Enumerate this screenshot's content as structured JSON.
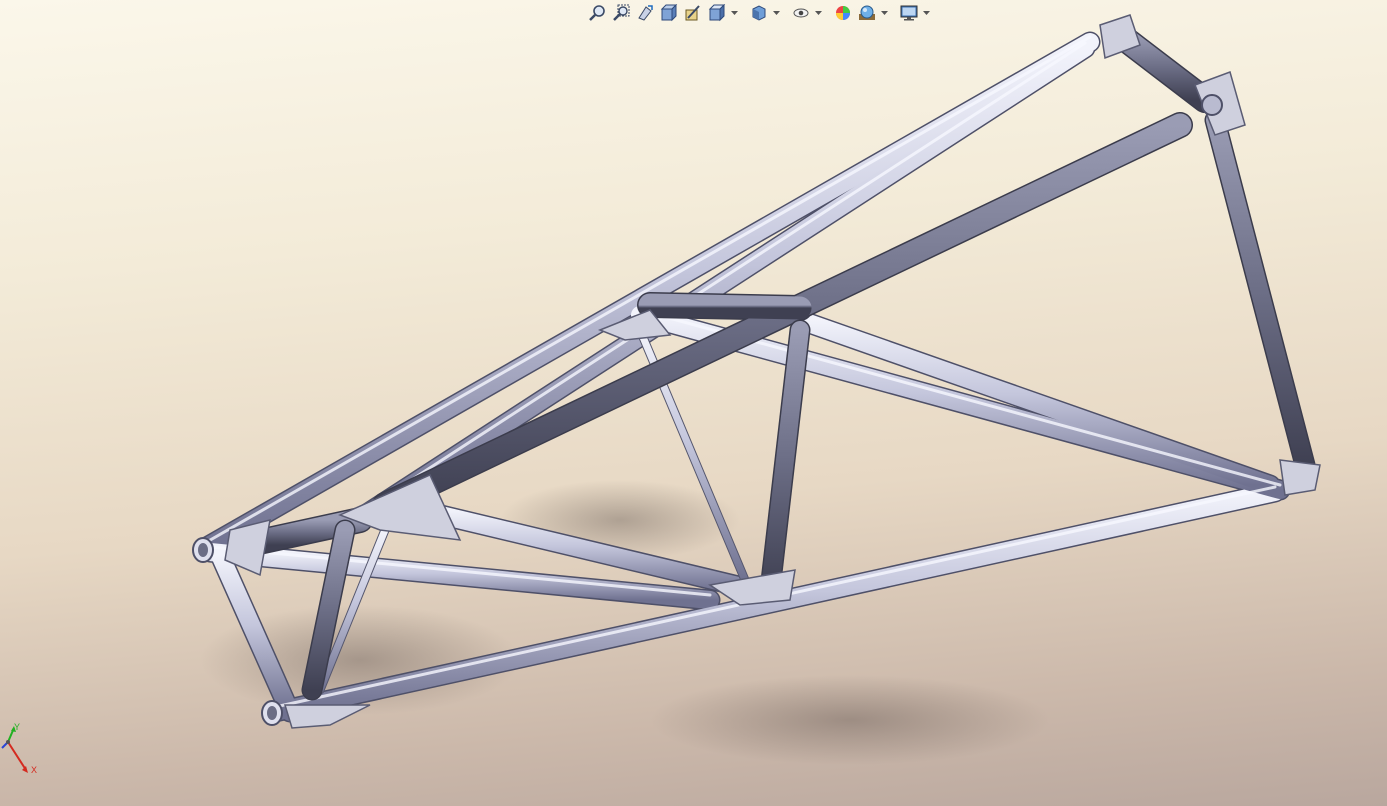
{
  "toolbar": {
    "buttons": [
      {
        "icon": "zoom-to-fit-icon"
      },
      {
        "icon": "zoom-to-area-icon"
      },
      {
        "icon": "previous-view-icon"
      },
      {
        "icon": "section-view-icon"
      },
      {
        "icon": "dynamic-annotation-icon"
      },
      {
        "icon": "view-orientation-icon",
        "dropdown": true
      },
      {
        "icon": "display-style-icon",
        "dropdown": true
      },
      {
        "icon": "hide-show-items-icon",
        "dropdown": true
      },
      {
        "icon": "edit-appearance-icon"
      },
      {
        "icon": "apply-scene-icon",
        "dropdown": true
      },
      {
        "icon": "view-settings-icon",
        "dropdown": true
      }
    ]
  },
  "triad": {
    "x_label": "X",
    "y_label": "Y",
    "x_color": "#d42a1f",
    "y_color": "#22b022"
  },
  "colors": {
    "tube_light": "#dfe0ee",
    "tube_mid": "#a9abc4",
    "tube_dark": "#6b6d85",
    "gusset": "#c9cad8"
  }
}
